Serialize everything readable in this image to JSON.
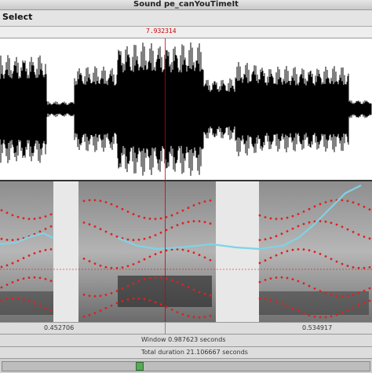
{
  "window": {
    "title": "Sound pe_canYouTimeIt"
  },
  "menu": {
    "select_label": "Select"
  },
  "cursor": {
    "time_label": "7.932314"
  },
  "time_bar": {
    "left_label": "0.452706",
    "right_label": "0.534917"
  },
  "status": {
    "window_label": "Window 0.987623 seconds",
    "total_label": "Total duration 21.106667 seconds"
  },
  "colors": {
    "waveform": "#000000",
    "pitch": "#7fd3e6",
    "formant": "#e02020",
    "cursor": "#cc0000"
  },
  "icons": {
    "scroll_thumb": "scroll-thumb-icon"
  }
}
